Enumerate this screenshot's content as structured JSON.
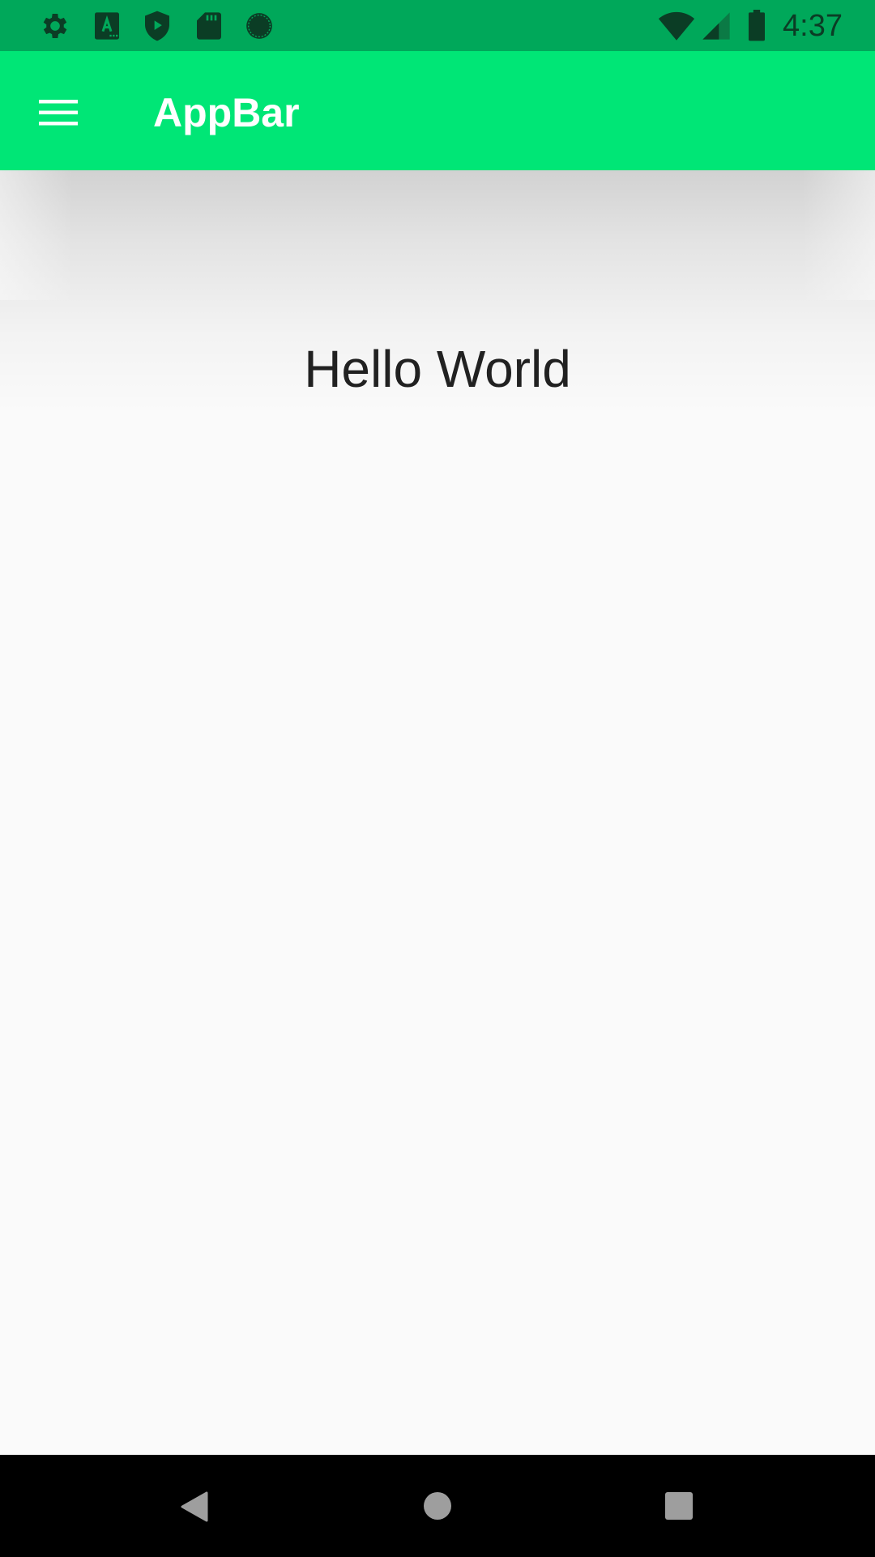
{
  "status_bar": {
    "time": "4:37",
    "left_icons": [
      "settings-icon",
      "keyboard-a-icon",
      "play-protect-icon",
      "sd-card-icon",
      "sync-circle-icon"
    ],
    "right_icons": [
      "wifi-icon",
      "cell-signal-icon",
      "battery-icon"
    ]
  },
  "app_bar": {
    "title": "AppBar",
    "menu_icon": "menu-icon"
  },
  "main": {
    "text": "Hello World"
  },
  "nav_bar": {
    "buttons": [
      "back-icon",
      "home-icon",
      "recents-icon"
    ]
  },
  "colors": {
    "status_bar": "#00a85a",
    "app_bar": "#00e676",
    "background": "#fafafa",
    "nav_bar": "#000000",
    "text": "#212121"
  }
}
